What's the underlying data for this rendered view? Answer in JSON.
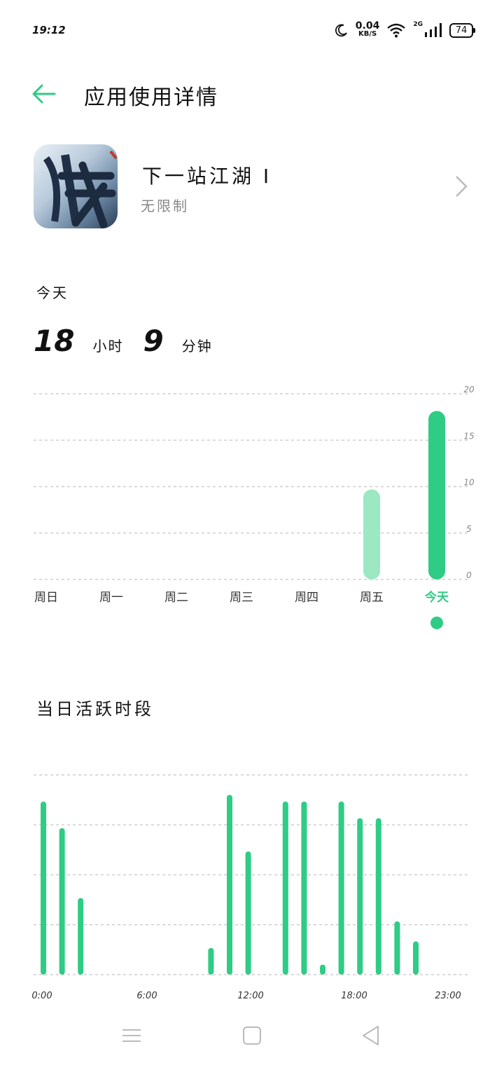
{
  "status_bar": {
    "time": "19:12",
    "speed_value": "0.04",
    "speed_unit": "KB/S",
    "network": "2G",
    "battery": "74",
    "icons": [
      "moon-icon",
      "wifi-icon",
      "signal-icon",
      "battery-icon"
    ]
  },
  "header": {
    "title": "应用使用详情",
    "back_icon": "arrow-left-icon",
    "accent_color": "#2ecc85"
  },
  "app": {
    "name": "下一站江湖 I",
    "limit": "无限制",
    "chevron_icon": "chevron-right-icon"
  },
  "today": {
    "label": "今天",
    "hours": "18",
    "hours_unit": "小时",
    "minutes": "9",
    "minutes_unit": "分钟"
  },
  "weekly": {
    "y_ticks": [
      "20",
      "15",
      "10",
      "5",
      "0"
    ],
    "ylim": [
      0,
      20
    ],
    "selected_index": 6
  },
  "active": {
    "title": "当日活跃时段"
  },
  "chart_data": [
    {
      "type": "bar",
      "categories": [
        "周日",
        "周一",
        "周二",
        "周三",
        "周四",
        "周五",
        "今天"
      ],
      "values": [
        0,
        0,
        0,
        0,
        0,
        9.7,
        18.15
      ],
      "ylim": [
        0,
        20
      ],
      "y_ticks": [
        20,
        15,
        10,
        5,
        0
      ],
      "grid": true,
      "colors": {
        "today": "#2ecc85",
        "past": "#9be8c3"
      }
    },
    {
      "type": "bar",
      "x_tick_labels": [
        "0:00",
        "6:00",
        "12:00",
        "18:00",
        "23:00"
      ],
      "values": [
        52,
        44,
        23,
        0,
        0,
        0,
        0,
        0,
        0,
        8,
        54,
        37,
        0,
        52,
        52,
        3,
        52,
        47,
        47,
        16,
        10,
        0,
        0,
        0
      ],
      "ylim": [
        0,
        60
      ],
      "grid": true,
      "color": "#2ecc85"
    }
  ],
  "nav": {
    "items": [
      "menu-icon",
      "home-square-icon",
      "back-triangle-icon"
    ]
  }
}
